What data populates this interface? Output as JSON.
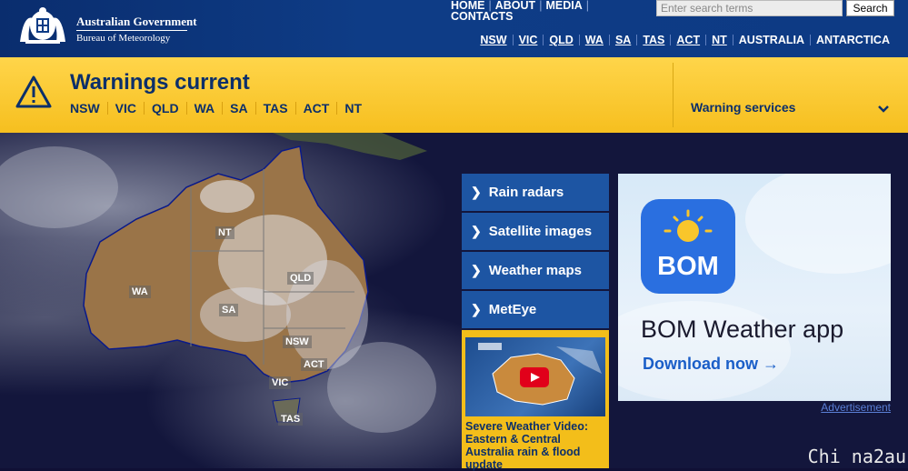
{
  "header": {
    "logo_line1": "Australian Government",
    "logo_line2": "Bureau of Meteorology",
    "top_links": [
      "HOME",
      "ABOUT",
      "MEDIA",
      "CONTACTS"
    ],
    "search": {
      "placeholder": "Enter search terms",
      "button": "Search"
    },
    "state_links": [
      "NSW",
      "VIC",
      "QLD",
      "WA",
      "SA",
      "TAS",
      "ACT",
      "NT"
    ],
    "region_links": [
      "AUSTRALIA",
      "ANTARCTICA"
    ]
  },
  "warnings": {
    "title": "Warnings current",
    "states": [
      "NSW",
      "VIC",
      "QLD",
      "WA",
      "SA",
      "TAS",
      "ACT",
      "NT"
    ],
    "services_label": "Warning services"
  },
  "map": {
    "labels": [
      "NT",
      "WA",
      "QLD",
      "SA",
      "NSW",
      "ACT",
      "VIC",
      "TAS"
    ]
  },
  "quick_links": [
    "Rain radars",
    "Satellite images",
    "Weather maps",
    "MetEye"
  ],
  "video": {
    "caption": "Severe Weather Video: Eastern & Central Australia rain & flood update"
  },
  "ad": {
    "app_icon_text": "BOM",
    "title": "BOM Weather app",
    "download": "Download now",
    "label": "Advertisement"
  },
  "watermark": "Chi na2au",
  "colors": {
    "header_blue": "#0e3c86",
    "warning_yellow": "#f9c62b",
    "link_blue": "#1d55a3",
    "title_navy": "#0c2f6a"
  }
}
